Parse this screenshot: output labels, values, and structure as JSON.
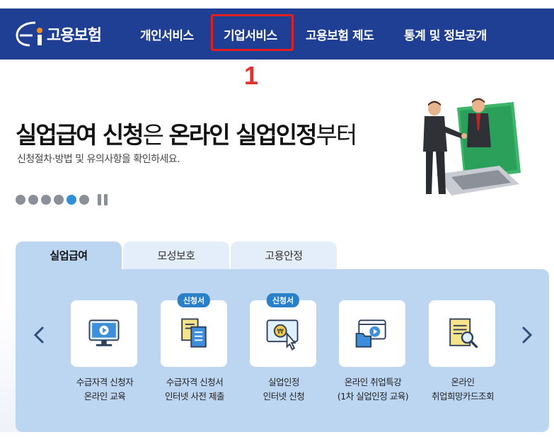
{
  "header": {
    "logo_text": "고용보험",
    "nav": [
      "개인서비스",
      "기업서비스",
      "고용보험 제도",
      "통계 및 정보공개"
    ],
    "annotation_number": "1"
  },
  "hero": {
    "title_part1": "실업급여 신청",
    "title_part2": "은 ",
    "title_part3": "온라인 실업인정",
    "title_part4": "부터",
    "subtitle": "신청절차·방법 및 유의사항을 확인하세요.",
    "slide_count": 6,
    "active_slide": 5
  },
  "tabs": [
    "실업급여",
    "모성보호",
    "고용안정"
  ],
  "services": [
    {
      "icon": "monitor-play-icon",
      "line1": "수급자격 신청자",
      "line2": "온라인 교육",
      "badge": ""
    },
    {
      "icon": "documents-icon",
      "line1": "수급자격 신청서",
      "line2": "인터넷 사전 제출",
      "badge": "신청서"
    },
    {
      "icon": "monitor-won-click-icon",
      "line1": "실업인정",
      "line2": "인터넷 신청",
      "badge": "신청서"
    },
    {
      "icon": "folder-video-icon",
      "line1": "온라인 취업특강",
      "line2": "(1차 실업인정 교육)",
      "badge": ""
    },
    {
      "icon": "card-search-icon",
      "line1": "온라인",
      "line2": "취업희망카드조회",
      "badge": ""
    }
  ],
  "colors": {
    "header_bg": "#1f3f94",
    "panel_bg": "#bcd6f2",
    "badge_bg": "#2a7fc9",
    "annotation_red": "#e02020"
  }
}
